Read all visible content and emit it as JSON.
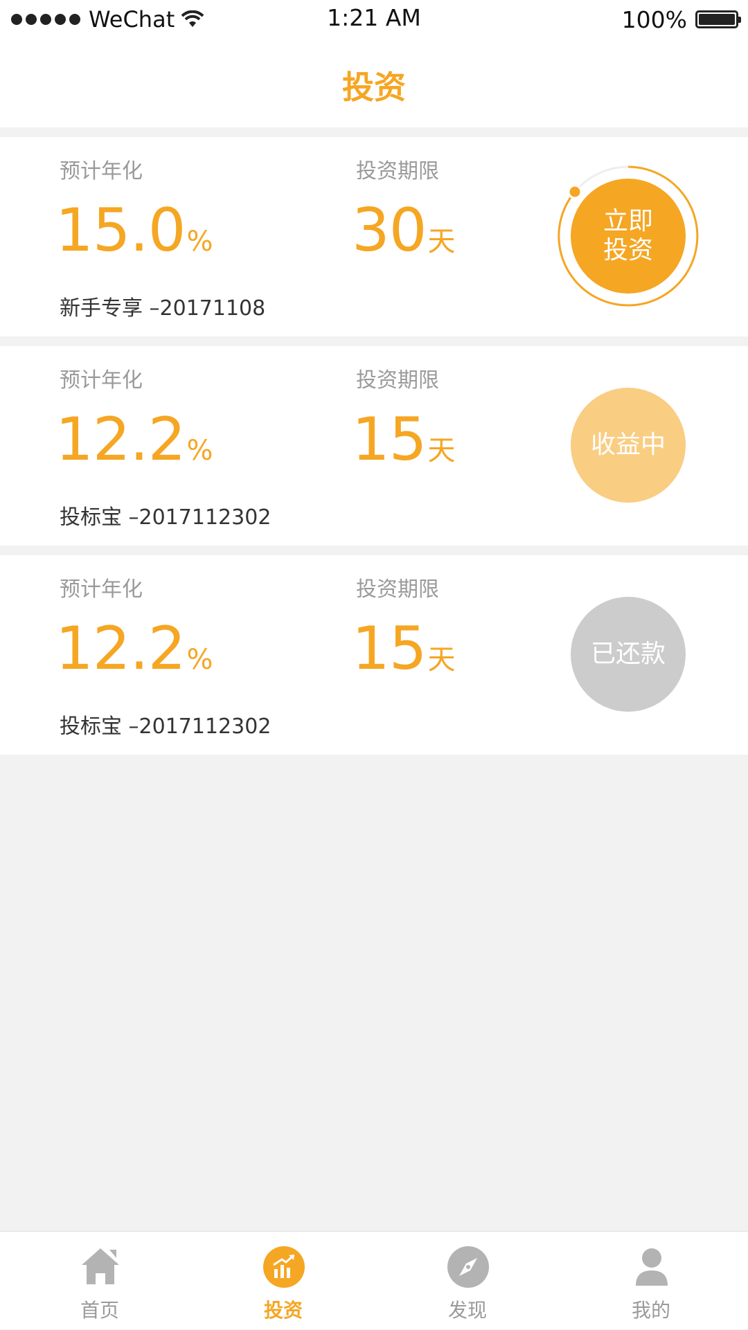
{
  "status_bar": {
    "carrier": "WeChat",
    "time": "1:21 AM",
    "battery": "100%"
  },
  "header": {
    "title": "投资"
  },
  "products": [
    {
      "rate_label": "预计年化",
      "rate_value": "15.0",
      "rate_unit": "%",
      "term_label": "投资期限",
      "term_value": "30",
      "term_unit": "天",
      "name": "新手专享 –20171108",
      "action_line1": "立即",
      "action_line2": "投资"
    },
    {
      "rate_label": "预计年化",
      "rate_value": "12.2",
      "rate_unit": "%",
      "term_label": "投资期限",
      "term_value": "15",
      "term_unit": "天",
      "name": "投标宝 –2017112302",
      "status": "收益中"
    },
    {
      "rate_label": "预计年化",
      "rate_value": "12.2",
      "rate_unit": "%",
      "term_label": "投资期限",
      "term_value": "15",
      "term_unit": "天",
      "name": "投标宝 –2017112302",
      "status": "已还款"
    }
  ],
  "tab_bar": {
    "items": [
      {
        "label": "首页",
        "icon": "home-icon"
      },
      {
        "label": "投资",
        "icon": "chart-icon",
        "active": true
      },
      {
        "label": "发现",
        "icon": "compass-icon"
      },
      {
        "label": "我的",
        "icon": "user-icon"
      }
    ]
  },
  "colors": {
    "accent": "#f5a623",
    "accent_light": "#f9cd82",
    "muted": "#cccccc",
    "background": "#f2f2f2"
  }
}
